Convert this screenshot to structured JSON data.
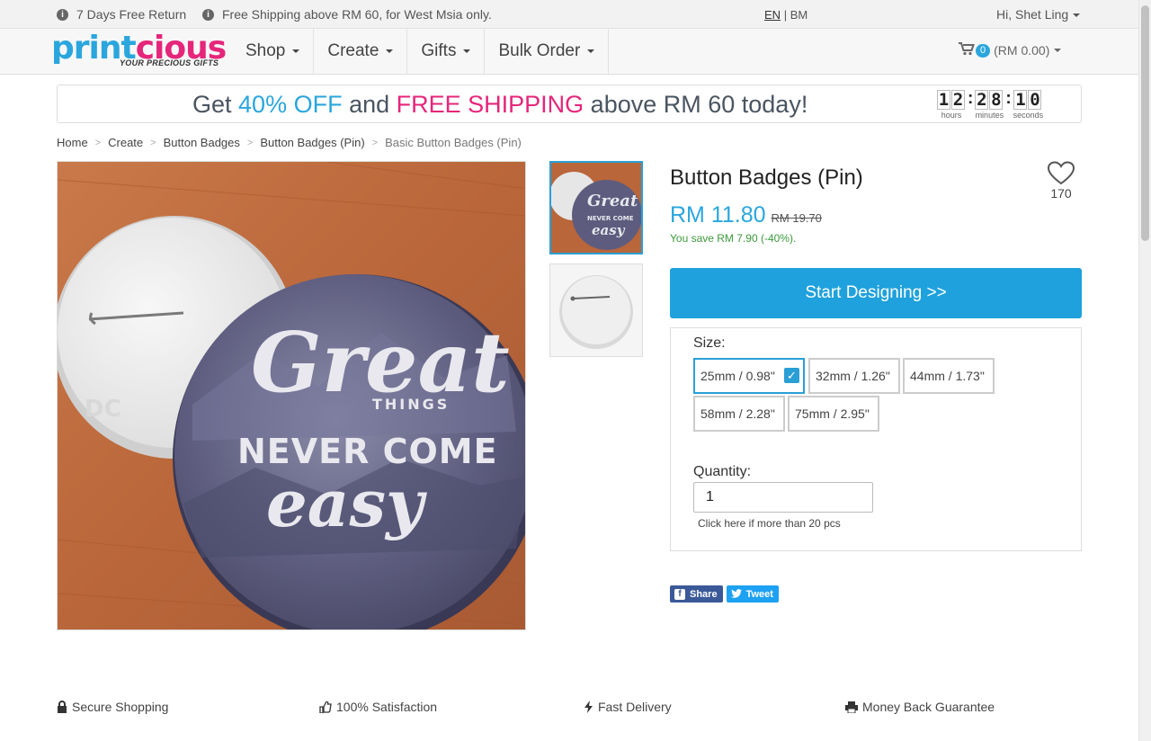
{
  "topbar": {
    "return_text": "7 Days Free Return",
    "shipping_text": "Free Shipping above RM 60, for West Msia only.",
    "lang_en": "EN",
    "lang_sep": "|",
    "lang_bm": "BM",
    "greeting": "Hi, Shet Ling"
  },
  "nav": {
    "logo_text": "printcious",
    "logo_tagline": "YOUR PRECIOUS GIFTS",
    "menu": [
      "Shop",
      "Create",
      "Gifts",
      "Bulk Order"
    ],
    "cart_count": "0",
    "cart_total": "(RM 0.00)"
  },
  "banner": {
    "text_1": "Get ",
    "highlight_1": "40% OFF",
    "text_2": " and ",
    "highlight_2": "FREE SHIPPING",
    "text_3": " above RM 60 today!",
    "timer": {
      "hours": [
        "1",
        "2"
      ],
      "minutes": [
        "2",
        "8"
      ],
      "seconds": [
        "1",
        "0"
      ],
      "hours_label": "hours",
      "minutes_label": "minutes",
      "seconds_label": "seconds"
    },
    "colors": {
      "blue": "#2aa6dd",
      "pink": "#e5267a"
    }
  },
  "breadcrumb": [
    "Home",
    "Create",
    "Button Badges",
    "Button Badges (Pin)",
    "Basic Button Badges (Pin)"
  ],
  "product": {
    "title": "Button Badges (Pin)",
    "wishlist_count": "170",
    "price": "RM 11.80",
    "old_price": "RM 19.70",
    "savings": "You save RM 7.90 (-40%).",
    "cta": "Start Designing >>",
    "badge_text_1": "Great",
    "badge_text_2": "THINGS",
    "badge_text_3": "NEVER COME",
    "badge_text_4": "easy",
    "size_label": "Size:",
    "sizes": [
      "25mm / 0.98\"",
      "32mm / 1.26\"",
      "44mm / 1.73\"",
      "58mm / 2.28\"",
      "75mm / 2.95\""
    ],
    "selected_size": "25mm / 0.98\"",
    "quantity_label": "Quantity:",
    "quantity_value": "1",
    "quantity_note": "Click here if more than 20 pcs"
  },
  "social": {
    "share": "Share",
    "tweet": "Tweet"
  },
  "features": [
    "Secure Shopping",
    "100% Satisfaction",
    "Fast Delivery",
    "Money Back Guarantee"
  ],
  "icons": {
    "return": "info-icon",
    "shipping": "info-icon",
    "cart": "cart-icon",
    "wishlist": "heart-icon",
    "secure": "lock-icon",
    "satisfaction": "thumbs-up-icon",
    "delivery": "bolt-icon",
    "guarantee": "printer-icon"
  }
}
